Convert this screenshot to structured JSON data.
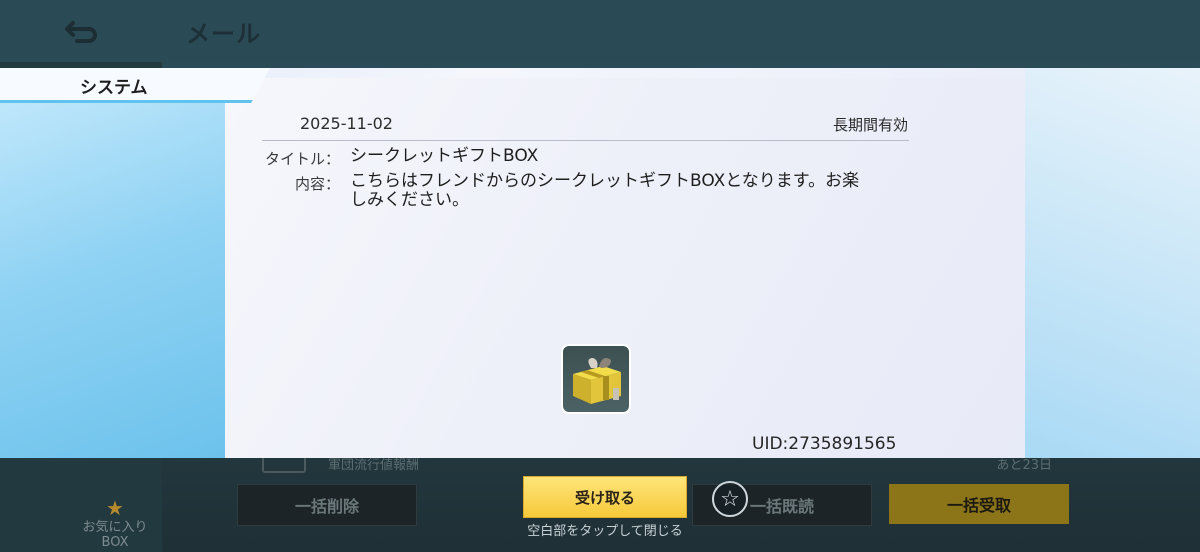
{
  "header": {
    "title": "メール",
    "back_icon": "back-arrow-icon"
  },
  "tab": {
    "label": "システム"
  },
  "mail": {
    "date": "2025-11-02",
    "validity": "長期間有効",
    "title_label": "タイトル：",
    "title_value": "シークレットギフトBOX",
    "content_label": "内容：",
    "content_line1": "こちらはフレンドからのシークレットギフトBOXとなります。お楽",
    "content_line2": "しみください。",
    "attachment_icon": "gift-box-icon",
    "uid": "UID:2735891565"
  },
  "background_list": {
    "row_title": "軍団流行値報酬",
    "row_days": "あと23日"
  },
  "footer": {
    "fav_label_line1": "お気に入り",
    "fav_label_line2": "BOX",
    "delete_all": "一括削除",
    "accept": "受け取る",
    "read_all": "一括既読",
    "receive_all": "一括受取",
    "close_hint": "空白部をタップして閉じる"
  },
  "colors": {
    "accent_blue": "#5fc2ef",
    "accept_gold": "#f6c93a",
    "notif_dot": "#ff8a00"
  }
}
